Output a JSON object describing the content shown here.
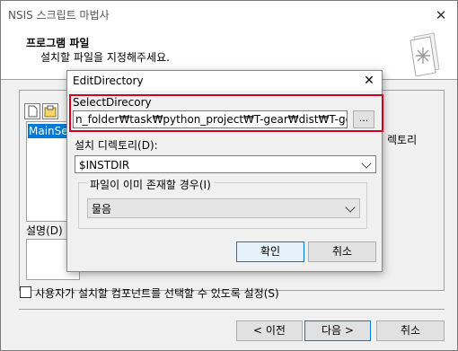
{
  "wizard": {
    "title": "NSIS 스크립트 마법사",
    "heading": "프로그램 파일",
    "subheading": "설치할 파일을 지정해주세요.",
    "tree_selected": "MainSection",
    "right_label": "렉토리",
    "description_label": "설명(D)",
    "checkbox_label": "사용자가 설치할 컴포넌트를 선택할 수 있도록 설정(S)",
    "buttons": {
      "back": "< 이전",
      "next": "다음 >",
      "cancel": "취소"
    }
  },
  "dialog": {
    "title": "EditDirectory",
    "select_label": "SelectDirecory",
    "select_value": "n_folder₩task₩python_project₩T-gear₩dist₩T-gear",
    "browse_label": "...",
    "install_label": "설치 디렉토리(D):",
    "install_value": "$INSTDIR",
    "group_label": "파일이 이미 존재할 경우(I)",
    "exists_value": "물음",
    "ok_label": "확인",
    "cancel_label": "취소"
  },
  "colors": {
    "accent": "#0078d7",
    "highlight_border": "#d0021b"
  }
}
